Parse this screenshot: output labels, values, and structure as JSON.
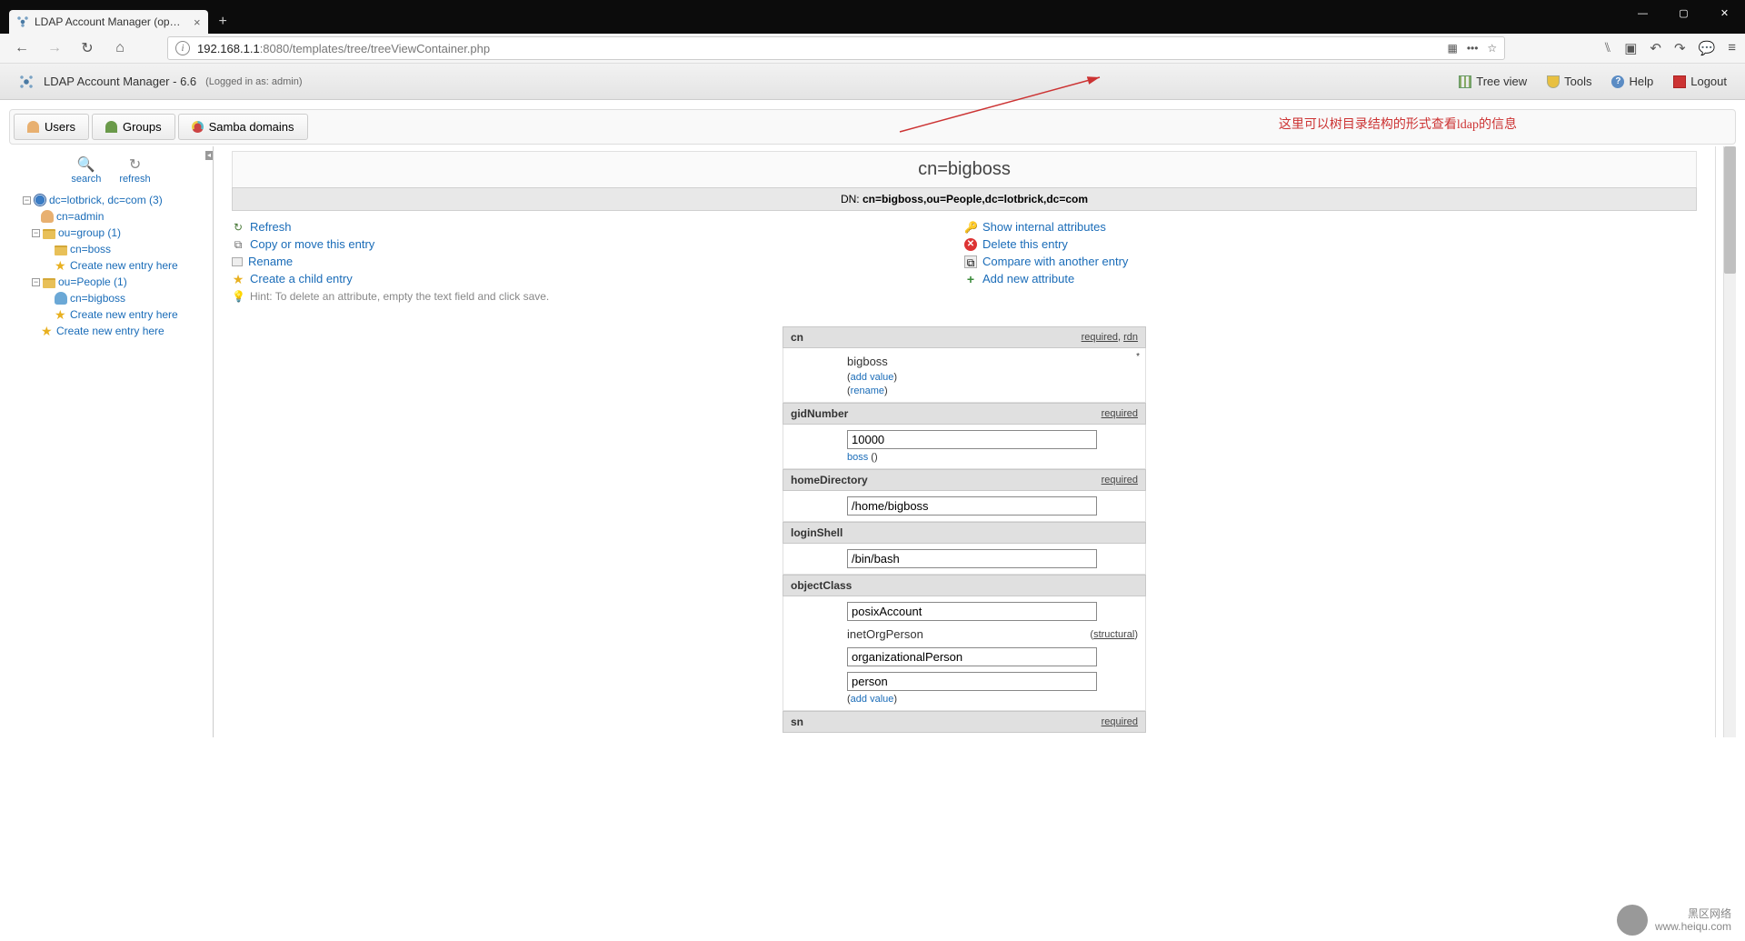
{
  "browser": {
    "tab_title": "LDAP Account Manager (op…",
    "url_prefix": "192.168.1.1",
    "url_suffix": ":8080/templates/tree/treeViewContainer.php",
    "newtab": "+",
    "win_min": "—",
    "win_max": "▢",
    "win_close": "✕"
  },
  "header": {
    "title": "LDAP Account Manager - 6.6",
    "login_info": "(Logged in as: admin)",
    "nav": {
      "tree_view": "Tree view",
      "tools": "Tools",
      "help": "Help",
      "logout": "Logout"
    }
  },
  "tabs": {
    "users": "Users",
    "groups": "Groups",
    "samba": "Samba domains"
  },
  "annotation": "这里可以树目录结构的形式查看ldap的信息",
  "tree_tools": {
    "search": "search",
    "refresh": "refresh"
  },
  "tree": {
    "root": "dc=lotbrick, dc=com (3)",
    "admin": "cn=admin",
    "group": "ou=group (1)",
    "boss": "cn=boss",
    "people": "ou=People (1)",
    "bigboss": "cn=bigboss",
    "create": "Create new entry here"
  },
  "entry": {
    "title": "cn=bigboss",
    "dn_label": "DN:",
    "dn": "cn=bigboss,ou=People,dc=lotbrick,dc=com"
  },
  "actions": {
    "refresh": "Refresh",
    "copy": "Copy or move this entry",
    "rename": "Rename",
    "create_child": "Create a child entry",
    "show_internal": "Show internal attributes",
    "delete": "Delete this entry",
    "compare": "Compare with another entry",
    "add_attr": "Add new attribute"
  },
  "hint": "Hint: To delete an attribute, empty the text field and click save.",
  "flags": {
    "required": "required",
    "rdn": "rdn",
    "structural": "structural"
  },
  "sublinks": {
    "add_value": "add value",
    "rename": "rename",
    "boss": "boss"
  },
  "attrs": {
    "cn": {
      "name": "cn",
      "value": "bigboss"
    },
    "gidNumber": {
      "name": "gidNumber",
      "value": "10000"
    },
    "homeDirectory": {
      "name": "homeDirectory",
      "value": "/home/bigboss"
    },
    "loginShell": {
      "name": "loginShell",
      "value": "/bin/bash"
    },
    "objectClass": {
      "name": "objectClass",
      "v1": "posixAccount",
      "v2": "inetOrgPerson",
      "v3": "organizationalPerson",
      "v4": "person"
    },
    "sn": {
      "name": "sn"
    }
  },
  "watermark": {
    "l1": "黑区网络",
    "l2": "www.heiqu.com"
  }
}
